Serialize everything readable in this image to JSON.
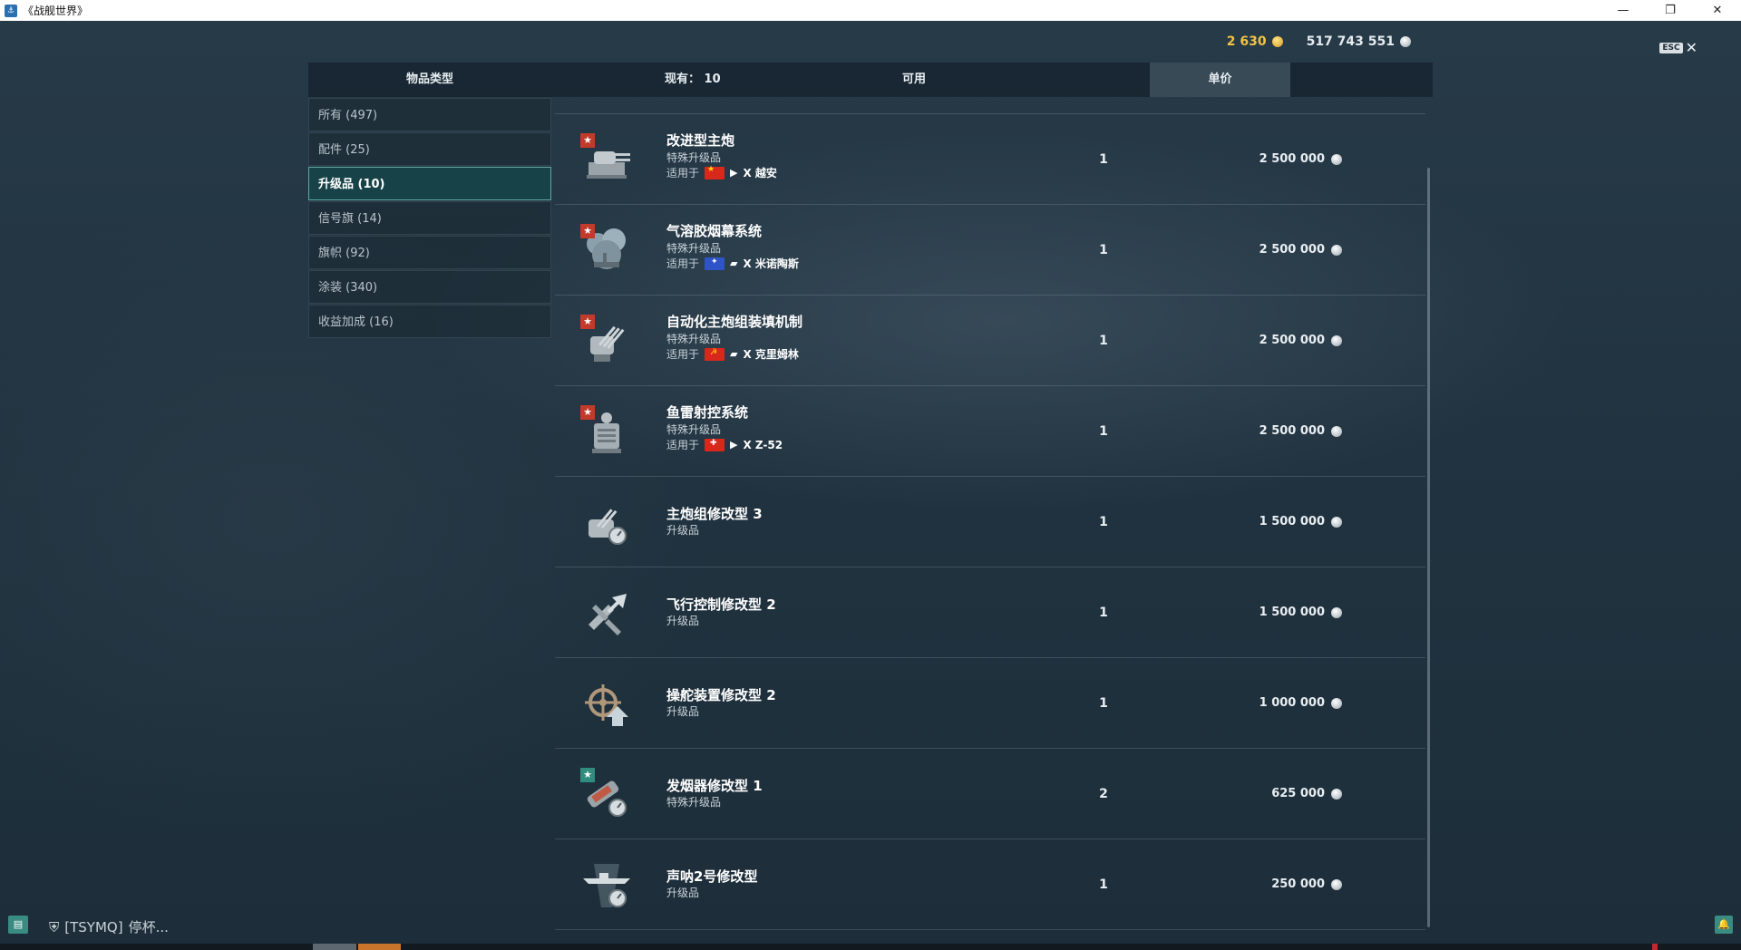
{
  "window": {
    "title": "《战舰世界》",
    "icon": "app-icon",
    "controls": [
      "minimize-icon",
      "restore-icon",
      "close-icon"
    ]
  },
  "currency": {
    "gold": "2 630",
    "silver": "517 743 551"
  },
  "esc": {
    "key": "ESC",
    "close": "✕"
  },
  "header": {
    "category": "物品类型",
    "count_label": "现有：",
    "count_value": "10",
    "available": "可用",
    "price": "单价"
  },
  "categories": [
    {
      "label": "所有 (497)",
      "active": false
    },
    {
      "label": "配件 (25)",
      "active": false
    },
    {
      "label": "升级品 (10)",
      "active": true
    },
    {
      "label": "信号旗 (14)",
      "active": false
    },
    {
      "label": "旗帜 (92)",
      "active": false
    },
    {
      "label": "涂装 (340)",
      "active": false
    },
    {
      "label": "收益加成 (16)",
      "active": false
    }
  ],
  "items": [
    {
      "name": "改进型主炮",
      "type": "特殊升级品",
      "applies_label": "适用于",
      "flag": "cn",
      "ship": "X 越安",
      "available": "1",
      "price": "2 500 000",
      "star": "red",
      "icon": "main-battery-icon"
    },
    {
      "name": "气溶胶烟幕系统",
      "type": "特殊升级品",
      "applies_label": "适用于",
      "flag": "pa",
      "ship": "X 米诺陶斯",
      "available": "1",
      "price": "2 500 000",
      "star": "red",
      "icon": "smoke-screen-icon"
    },
    {
      "name": "自动化主炮组装填机制",
      "type": "特殊升级品",
      "applies_label": "适用于",
      "flag": "su",
      "ship": "X 克里姆林",
      "available": "1",
      "price": "2 500 000",
      "star": "red",
      "icon": "autoloader-icon"
    },
    {
      "name": "鱼雷射控系统",
      "type": "特殊升级品",
      "applies_label": "适用于",
      "flag": "de",
      "ship": "X Z-52",
      "available": "1",
      "price": "2 500 000",
      "star": "red",
      "icon": "torpedo-fire-control-icon"
    },
    {
      "name": "主炮组修改型 3",
      "type": "升级品",
      "available": "1",
      "price": "1 500 000",
      "icon": "main-battery-mod-icon"
    },
    {
      "name": "飞行控制修改型 2",
      "type": "升级品",
      "available": "1",
      "price": "1 500 000",
      "icon": "flight-control-icon"
    },
    {
      "name": "操舵装置修改型 2",
      "type": "升级品",
      "available": "1",
      "price": "1 000 000",
      "icon": "steering-gear-icon"
    },
    {
      "name": "发烟器修改型 1",
      "type": "特殊升级品",
      "available": "2",
      "price": "625 000",
      "star": "green",
      "icon": "smoke-generator-icon"
    },
    {
      "name": "声呐2号修改型",
      "type": "升级品",
      "available": "1",
      "price": "250 000",
      "icon": "sonar-icon"
    }
  ],
  "bottom": {
    "chat_icon": "chat-icon",
    "clan_tag": "[TSYMQ]",
    "clan_text": "停杯...",
    "bell_icon": "bell-icon"
  }
}
